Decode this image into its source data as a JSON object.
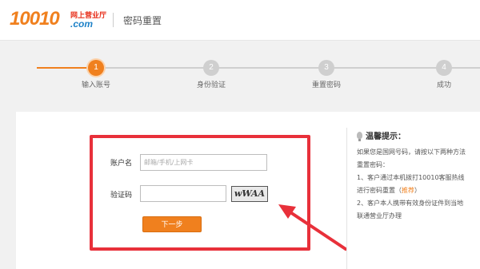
{
  "header": {
    "logo_number": "10010",
    "logo_top": "网上营业厅",
    "logo_com": ".com",
    "title": "密码重置"
  },
  "steps": [
    {
      "number": "1",
      "label": "输入账号",
      "state": "active"
    },
    {
      "number": "2",
      "label": "身份验证",
      "state": "pending"
    },
    {
      "number": "3",
      "label": "重置密码",
      "state": "pending"
    },
    {
      "number": "4",
      "label": "成功",
      "state": "pending"
    }
  ],
  "form": {
    "account_label": "账户名",
    "account_placeholder": "邮箱/手机/上网卡",
    "captcha_label": "验证码",
    "captcha_value": "",
    "captcha_image_text": "wWAA",
    "next_button": "下一步"
  },
  "tips": {
    "title": "温馨提示：",
    "line1": "如果您是国网号码，请按以下两种方法",
    "line2": "重置密码：",
    "line3": "1、客户通过本机拨打10010客服热线",
    "line4_pre": "进行密码重置（",
    "line4_link": "推荐",
    "line4_post": "）",
    "line5": "2、客户本人携带有效身份证件到当地",
    "line6": "联通营业厅办理"
  },
  "colors": {
    "accent": "#f0801e",
    "highlight_box": "#e8303a",
    "logo_com": "#1e82c8"
  }
}
